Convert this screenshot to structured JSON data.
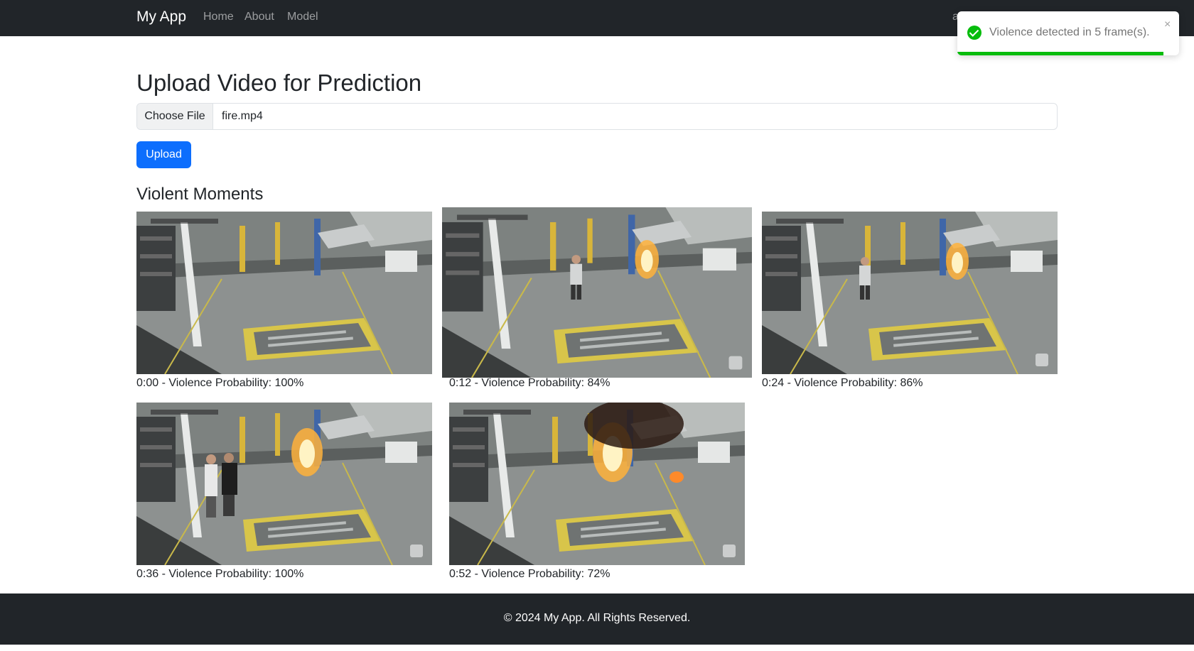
{
  "nav": {
    "brand": "My App",
    "links": [
      "Home",
      "About",
      "Model"
    ],
    "user_text": "a"
  },
  "upload": {
    "title": "Upload Video for Prediction",
    "choose_label": "Choose File",
    "file_name": "fire.mp4",
    "button_label": "Upload"
  },
  "results": {
    "title": "Violent Moments",
    "frames": [
      {
        "caption": "0:00 - Violence Probability: 100%",
        "time": "0:00",
        "probability": 100,
        "fire": 0
      },
      {
        "caption": "0:12 - Violence Probability: 84%",
        "time": "0:12",
        "probability": 84,
        "fire": 1
      },
      {
        "caption": "0:24 - Violence Probability: 86%",
        "time": "0:24",
        "probability": 86,
        "fire": 1
      },
      {
        "caption": "0:36 - Violence Probability: 100%",
        "time": "0:36",
        "probability": 100,
        "fire": 2
      },
      {
        "caption": "0:52 - Violence Probability: 72%",
        "time": "0:52",
        "probability": 72,
        "fire": 3
      }
    ]
  },
  "toast": {
    "message": "Violence detected in 5 frame(s).",
    "close": "×",
    "progress": 0.93,
    "color": "#07bc0c"
  },
  "footer": {
    "text": "© 2024 My App. All Rights Reserved."
  }
}
